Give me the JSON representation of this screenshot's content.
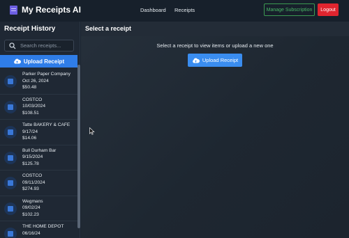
{
  "header": {
    "title": "My Receipts AI",
    "nav": [
      "Dashboard",
      "Receipts"
    ],
    "manage_label": "Manage Subscription",
    "logout_label": "Logout"
  },
  "sidebar": {
    "title": "Receipt History",
    "search_placeholder": "Search receipts...",
    "upload_label": "Upload Receipt",
    "receipts": [
      {
        "store": "Parker Paper Company",
        "date": "Oct 26, 2024",
        "amount": "$50.48"
      },
      {
        "store": "COSTCO",
        "date": "10/03/2024",
        "amount": "$108.51"
      },
      {
        "store": "Tatte BAKERY & CAFE",
        "date": "9/17/24",
        "amount": "$14.06"
      },
      {
        "store": "Bull Durham Bar",
        "date": "9/15/2024",
        "amount": "$125.78"
      },
      {
        "store": "COSTCO",
        "date": "09/11/2024",
        "amount": "$274.93"
      },
      {
        "store": "Wegmans",
        "date": "09/02/24",
        "amount": "$102.23"
      },
      {
        "store": "THE HOME DEPOT",
        "date": "06/16/24",
        "amount": ""
      }
    ]
  },
  "main": {
    "title": "Select a receipt",
    "message": "Select a receipt to view items or upload a new one",
    "upload_label": "Upload Receipt"
  },
  "colors": {
    "accent": "#2f7de8",
    "logout": "#e0252f",
    "manage": "#49b865"
  },
  "icons": [
    "receipt-icon",
    "search-icon",
    "cloud-upload-icon",
    "mouse-cursor-icon"
  ]
}
